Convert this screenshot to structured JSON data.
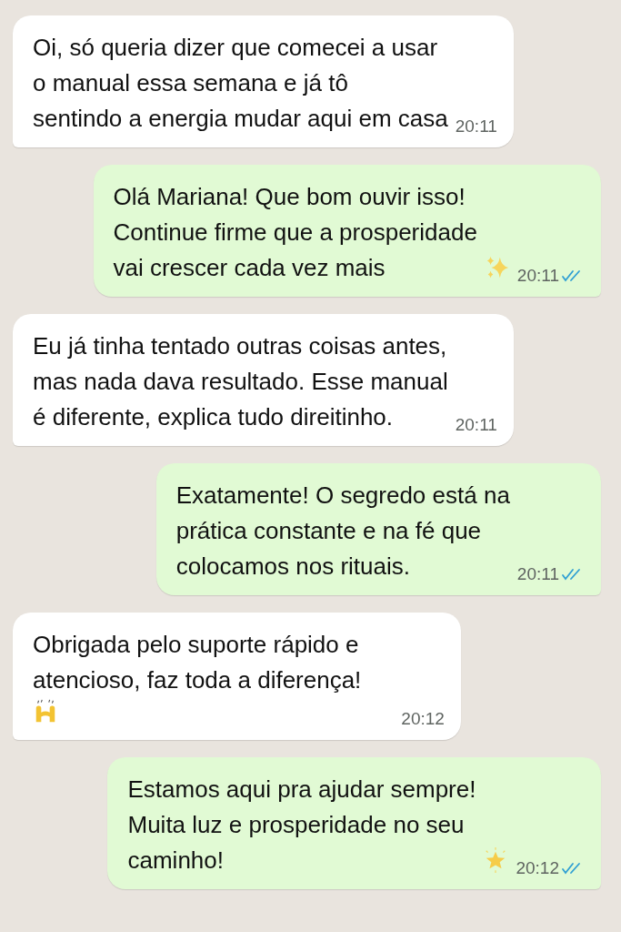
{
  "messages": [
    {
      "outgoing": false,
      "text": "Oi, só queria dizer que comecei a usar\no manual essa semana e já tô\nsentindo a energia mudar aqui em casa",
      "time": "20:11"
    },
    {
      "outgoing": true,
      "text": "Olá Mariana! Que bom ouvir isso!\nContinue firme que a prosperidade\nvai crescer cada vez mais",
      "emoji": {
        "kind": "sparkles"
      },
      "time": "20:11",
      "read": true
    },
    {
      "outgoing": false,
      "text": "Eu já tinha tentado outras coisas antes,\nmas nada dava resultado. Esse manual\né diferente, explica tudo direitinho.",
      "time": "20:11"
    },
    {
      "outgoing": true,
      "text": "Exatamente! O segredo está na\nprática constante e na fé que\ncolocamos nos rituais.",
      "time": "20:11",
      "read": true
    },
    {
      "outgoing": false,
      "text": "Obrigada pelo suporte rápido e\natencioso, faz toda a diferença!",
      "emoji": {
        "kind": "hands"
      },
      "emoji_on_own_line": true,
      "time": "20:12"
    },
    {
      "outgoing": true,
      "text": "Estamos aqui pra ajudar sempre!\nMuita luz e prosperidade no seu\ncaminho!",
      "emoji": {
        "kind": "star"
      },
      "time": "20:12",
      "read": true
    }
  ]
}
